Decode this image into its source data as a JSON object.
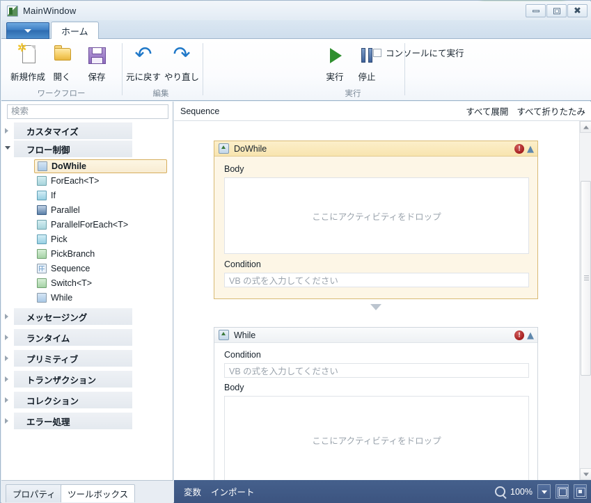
{
  "window": {
    "title": "MainWindow",
    "icon": "app-window-icon",
    "buttons": {
      "minimize": "–",
      "maximize": "□",
      "close": "✕"
    }
  },
  "ribbon": {
    "app_menu_icon": "chevron-down-icon",
    "tabs": [
      {
        "label": "ホーム",
        "active": true
      }
    ],
    "groups": [
      {
        "label": "ワークフロー",
        "buttons": [
          {
            "label": "新規作成",
            "icon": "new-file-icon"
          },
          {
            "label": "開く",
            "icon": "open-folder-icon"
          },
          {
            "label": "保存",
            "icon": "save-floppy-icon"
          }
        ]
      },
      {
        "label": "編集",
        "buttons": [
          {
            "label": "元に戻す",
            "icon": "undo-arrow-icon"
          },
          {
            "label": "やり直し",
            "icon": "redo-arrow-icon"
          }
        ]
      },
      {
        "label": "実行",
        "buttons": [
          {
            "label": "実行",
            "icon": "play-icon"
          },
          {
            "label": "停止",
            "icon": "pause-icon"
          }
        ],
        "checkbox": {
          "label": "コンソールにて実行",
          "checked": false
        }
      }
    ]
  },
  "toolbox": {
    "search": {
      "placeholder": "検索",
      "value": ""
    },
    "categories": [
      {
        "label": "カスタマイズ",
        "expanded": false,
        "items": []
      },
      {
        "label": "フロー制御",
        "expanded": true,
        "items": [
          {
            "label": "DoWhile",
            "icon": "dowhile-icon",
            "selected": true
          },
          {
            "label": "ForEach<T>",
            "icon": "foreach-icon",
            "selected": false
          },
          {
            "label": "If",
            "icon": "if-icon",
            "selected": false
          },
          {
            "label": "Parallel",
            "icon": "parallel-icon",
            "selected": false
          },
          {
            "label": "ParallelForEach<T>",
            "icon": "parallel-foreach-icon",
            "selected": false
          },
          {
            "label": "Pick",
            "icon": "pick-icon",
            "selected": false
          },
          {
            "label": "PickBranch",
            "icon": "pickbranch-icon",
            "selected": false
          },
          {
            "label": "Sequence",
            "icon": "sequence-icon",
            "selected": false
          },
          {
            "label": "Switch<T>",
            "icon": "switch-icon",
            "selected": false
          },
          {
            "label": "While",
            "icon": "while-icon",
            "selected": false
          }
        ]
      },
      {
        "label": "メッセージング",
        "expanded": false,
        "items": []
      },
      {
        "label": "ランタイム",
        "expanded": false,
        "items": []
      },
      {
        "label": "プリミティブ",
        "expanded": false,
        "items": []
      },
      {
        "label": "トランザクション",
        "expanded": false,
        "items": []
      },
      {
        "label": "コレクション",
        "expanded": false,
        "items": []
      },
      {
        "label": "エラー処理",
        "expanded": false,
        "items": []
      }
    ],
    "panel_tabs": [
      {
        "label": "プロパティ",
        "active": false
      },
      {
        "label": "ツールボックス",
        "active": true
      }
    ]
  },
  "designer": {
    "breadcrumb": "Sequence",
    "expand_all": "すべて展開",
    "collapse_all": "すべて折りたたみ",
    "activities": [
      {
        "title": "DoWhile",
        "icon": "dowhile-activity-icon",
        "has_error": true,
        "collapse_icon": "chevron-up-icon",
        "fields": [
          {
            "label": "Body",
            "type": "dropzone",
            "placeholder": "ここにアクティビティをドロップ"
          },
          {
            "label": "Condition",
            "type": "expression",
            "placeholder": "VB の式を入力してください",
            "value": ""
          }
        ]
      },
      {
        "title": "While",
        "icon": "while-activity-icon",
        "has_error": true,
        "collapse_icon": "chevron-up-icon",
        "fields": [
          {
            "label": "Condition",
            "type": "expression",
            "placeholder": "VB の式を入力してください",
            "value": ""
          },
          {
            "label": "Body",
            "type": "dropzone",
            "placeholder": "ここにアクティビティをドロップ"
          }
        ]
      }
    ]
  },
  "statusbar": {
    "variables": "変数",
    "imports": "インポート",
    "zoom_icon": "magnifier-icon",
    "zoom_value": "100%",
    "zoom_dropdown_icon": "chevron-down-icon",
    "fit_icon": "fit-to-screen-icon",
    "actual_icon": "actual-size-icon"
  },
  "colors": {
    "accent": "#45608c",
    "activity_amber_border": "#d8ba74",
    "activity_amber_bg": "#fdf6e6",
    "error_red": "#a51f1f",
    "selection_gold": "#d6ae5e"
  }
}
